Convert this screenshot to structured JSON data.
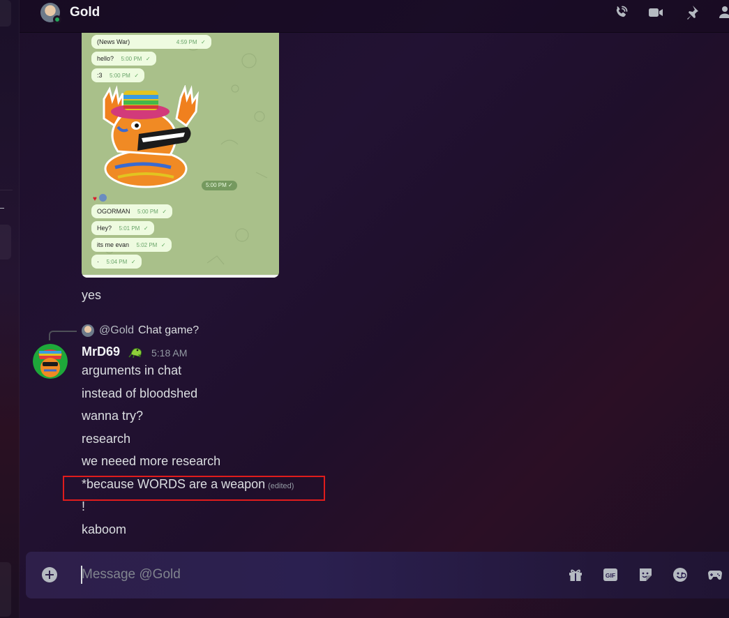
{
  "header": {
    "title": "Gold",
    "icons": [
      "phone-call-icon",
      "video-camera-icon",
      "pin-icon",
      "add-friends-icon"
    ]
  },
  "screenshot": {
    "bubbles": [
      {
        "text": "(News War)",
        "time": "4:59 PM"
      },
      {
        "text": "hello?",
        "time": "5:00 PM"
      },
      {
        "text": ":3",
        "time": "5:00 PM"
      },
      {
        "text": "OGORMAN",
        "time": "5:00 PM"
      },
      {
        "text": "Hey?",
        "time": "5:01 PM"
      },
      {
        "text": "its me evan",
        "time": "5:02 PM"
      },
      {
        "text": "·",
        "time": "5:04 PM"
      }
    ],
    "sticker_time": "5:00 PM",
    "checkmark": "✓"
  },
  "messages": {
    "yes": "yes",
    "reply": {
      "mention": "@Gold",
      "text": "Chat game?"
    },
    "author": "MrD69",
    "timestamp": "5:18 AM",
    "lines": [
      "arguments in chat",
      "instead of bloodshed",
      "wanna try?",
      "research",
      "we neeed more research",
      "*because WORDS are a weapon",
      "!",
      "kaboom"
    ],
    "edited": "(edited)"
  },
  "composer": {
    "placeholder": "Message @Gold",
    "gif_label": "GIF",
    "icons": [
      "add-attachment-icon",
      "gift-icon",
      "gif-icon",
      "sticker-icon",
      "emoji-icon",
      "activity-icon"
    ]
  },
  "colors": {
    "accent_red_box": "#e01c1c",
    "online_status": "#23a55a"
  }
}
